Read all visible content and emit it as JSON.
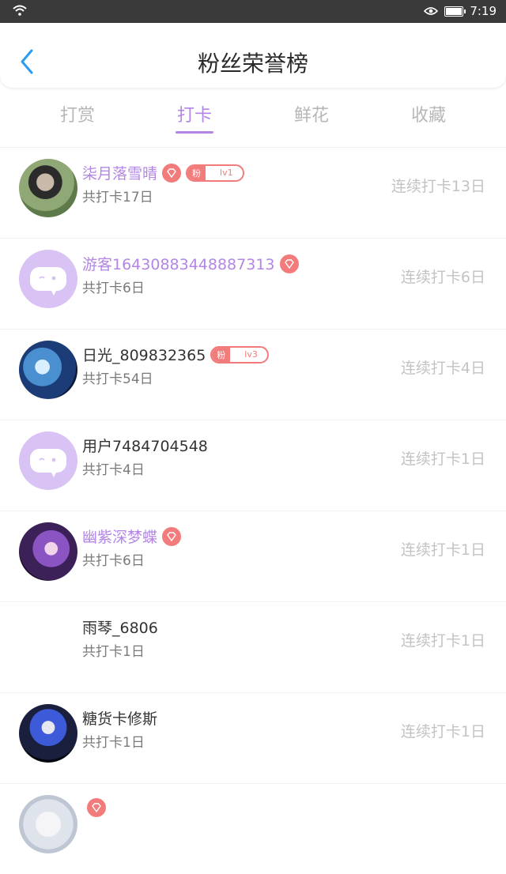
{
  "status_bar": {
    "time": "7:19"
  },
  "header": {
    "title": "粉丝荣誉榜"
  },
  "tabs": [
    {
      "label": "打赏",
      "active": false
    },
    {
      "label": "打卡",
      "active": true
    },
    {
      "label": "鲜花",
      "active": false
    },
    {
      "label": "收藏",
      "active": false
    }
  ],
  "list": [
    {
      "name": "柒月落雪晴",
      "total": "共打卡17日",
      "streak": "连续打卡13日",
      "diamond": true,
      "badge_fen": "粉",
      "level": "lv1",
      "avatar": "photo"
    },
    {
      "name": "游客16430883448887313",
      "total": "共打卡6日",
      "streak": "连续打卡6日",
      "diamond": true,
      "avatar": "placeholder"
    },
    {
      "name": "日光_809832365",
      "total": "共打卡54日",
      "streak": "连续打卡4日",
      "diamond": false,
      "badge_fen": "粉",
      "level": "lv3",
      "avatar": "photo"
    },
    {
      "name": "用户7484704548",
      "total": "共打卡4日",
      "streak": "连续打卡1日",
      "diamond": false,
      "avatar": "placeholder"
    },
    {
      "name": "幽紫深梦蝶",
      "total": "共打卡6日",
      "streak": "连续打卡1日",
      "diamond": true,
      "avatar": "photo"
    },
    {
      "name": "雨琴_6806",
      "total": "共打卡1日",
      "streak": "连续打卡1日",
      "diamond": false,
      "avatar": "none"
    },
    {
      "name": "糖货卡修斯",
      "total": "共打卡1日",
      "streak": "连续打卡1日",
      "diamond": false,
      "avatar": "photo"
    },
    {
      "name": "",
      "total": "",
      "streak": "",
      "diamond": true,
      "avatar": "photo"
    }
  ],
  "colors": {
    "accent": "#b386e6",
    "badge": "#f27b7b",
    "avatar_placeholder": "#d9c3f5"
  },
  "icons": {
    "back": "chevron-left-icon",
    "diamond": "diamond-icon"
  }
}
